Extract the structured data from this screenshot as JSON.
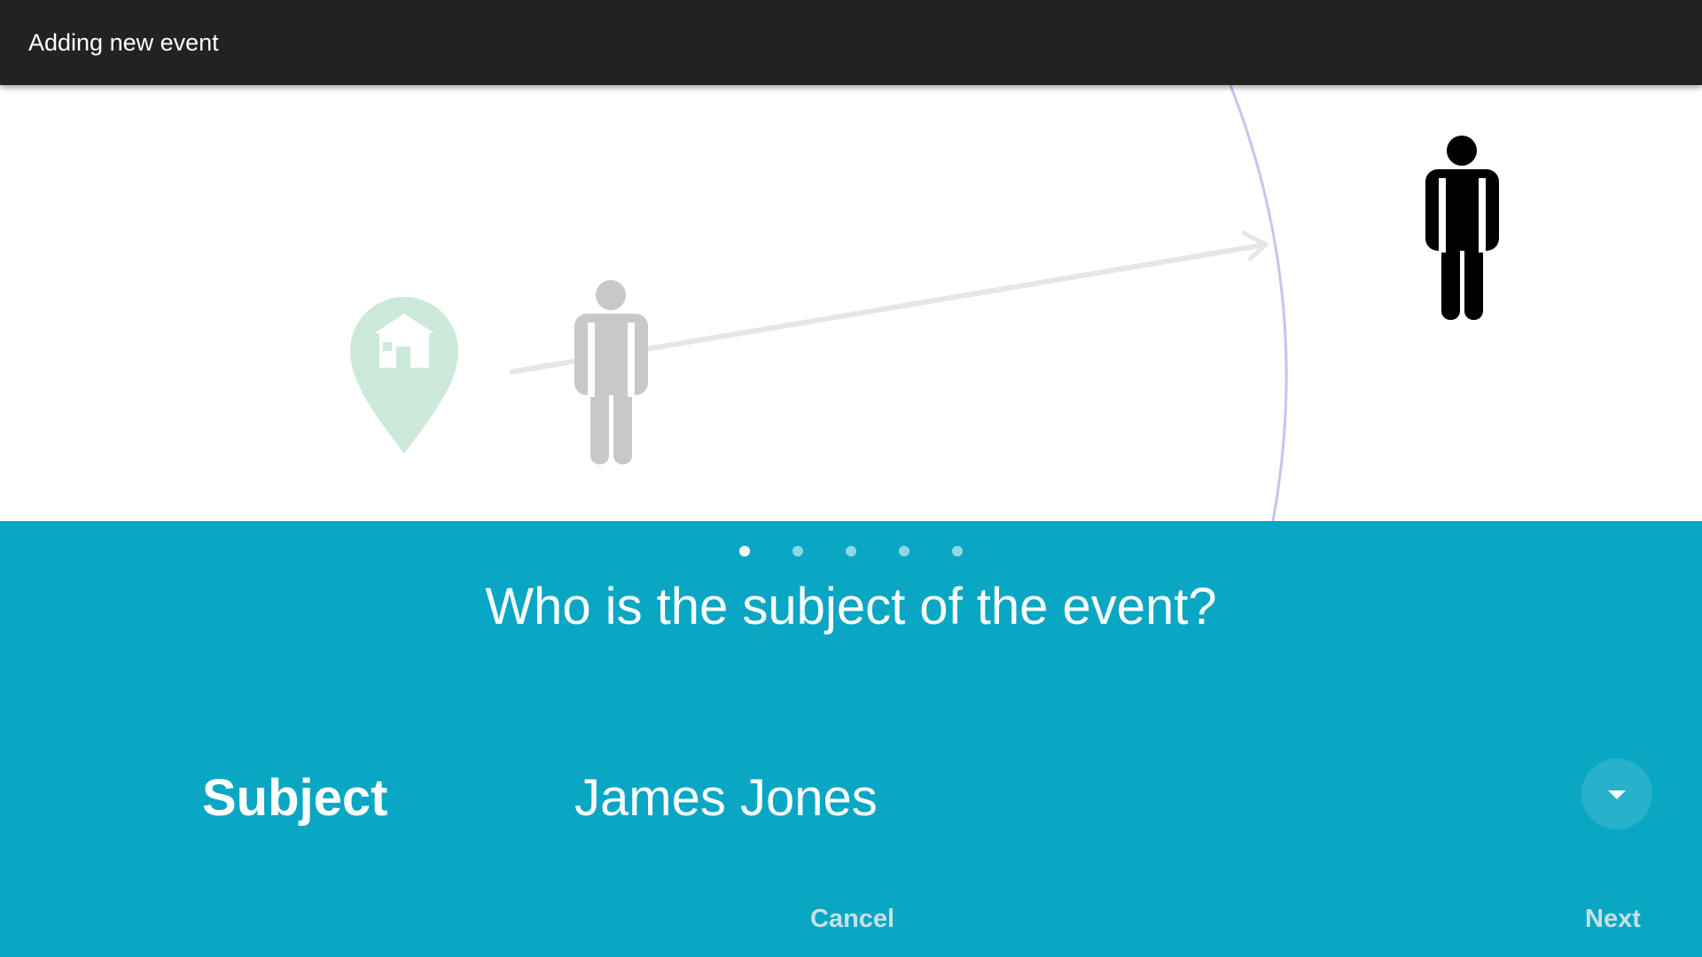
{
  "titlebar": {
    "title": "Adding new event"
  },
  "illustration": {
    "icons": [
      "location-pin-icon",
      "house-icon",
      "person-icon-gray",
      "person-icon-black",
      "arrow-icon"
    ],
    "colors": {
      "pin": "#cce9da",
      "person_inactive": "#c8c8c8",
      "person_active": "#000000",
      "arrow": "#e6e6e6",
      "arc": "#c5c5f2"
    }
  },
  "wizard": {
    "steps_total": 5,
    "current_step": 1,
    "question": "Who is the subject of the event?",
    "field": {
      "label": "Subject",
      "value": "James Jones"
    },
    "buttons": {
      "cancel": "Cancel",
      "next": "Next"
    }
  },
  "colors": {
    "titlebar": "#222222",
    "panel": "#0aa7c4",
    "button_text": "#c9dfe6"
  }
}
